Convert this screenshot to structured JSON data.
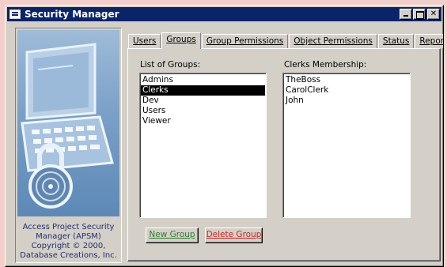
{
  "window": {
    "title": "Security Manager",
    "controls": [
      "minimize",
      "maximize",
      "close"
    ]
  },
  "side": {
    "caption_lines": [
      "Access Project Security",
      "Manager (APSM)",
      "Copyright © 2000,",
      "Database Creations, Inc."
    ]
  },
  "tabs": [
    {
      "label": "Users",
      "active": false
    },
    {
      "label": "Groups",
      "active": true
    },
    {
      "label": "Group Permissions",
      "active": false
    },
    {
      "label": "Object Permissions",
      "active": false
    },
    {
      "label": "Status",
      "active": false
    },
    {
      "label": "Reports",
      "active": false
    }
  ],
  "groups": {
    "list_label": "List of Groups:",
    "items": [
      "Admins",
      "Clerks",
      "Dev",
      "Users",
      "Viewer"
    ],
    "selected": "Clerks"
  },
  "membership": {
    "label": "Clerks Membership:",
    "items": [
      "TheBoss",
      "CarolClerk",
      "John"
    ]
  },
  "buttons": {
    "new_group": "New Group",
    "delete_group": "Delete Group"
  },
  "colors": {
    "titlebar": "#0a246a",
    "desktop": "#f2cfcb",
    "face": "#d4d0c8",
    "new_group_text": "#2e7d32",
    "delete_group_text": "#c62828",
    "caption_text": "#1f2f6e"
  }
}
